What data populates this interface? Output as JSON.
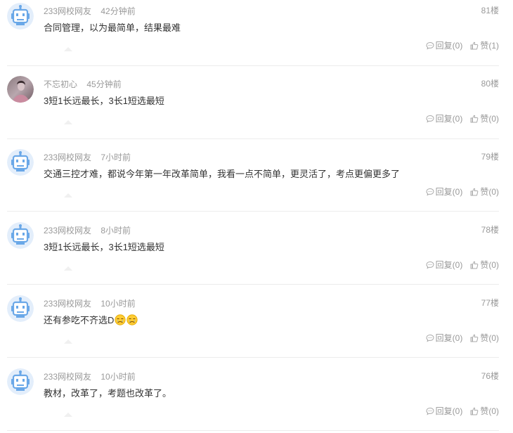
{
  "comments": [
    {
      "user": "233网校网友",
      "time": "42分钟前",
      "floor": "81楼",
      "content": "合同管理，以为最简单，结果最难",
      "reply_label": "回复(0)",
      "like_label": "赞(1)",
      "avatar": "robot-avatar"
    },
    {
      "user": "不忘初心",
      "time": "45分钟前",
      "floor": "80楼",
      "content": "3短1长远最长，3长1短选最短",
      "reply_label": "回复(0)",
      "like_label": "赞(0)",
      "avatar": "photo-avatar"
    },
    {
      "user": "233网校网友",
      "time": "7小时前",
      "floor": "79楼",
      "content": "交通三控才难，都说今年第一年改革简单，我看一点不简单，更灵活了，考点更偏更多了",
      "reply_label": "回复(0)",
      "like_label": "赞(0)",
      "avatar": "robot-avatar"
    },
    {
      "user": "233网校网友",
      "time": "8小时前",
      "floor": "78楼",
      "content": "3短1长远最长，3长1短选最短",
      "reply_label": "回复(0)",
      "like_label": "赞(0)",
      "avatar": "robot-avatar"
    },
    {
      "user": "233网校网友",
      "time": "10小时前",
      "floor": "77楼",
      "content": "还有参吃不齐选D",
      "reply_label": "回复(0)",
      "like_label": "赞(0)",
      "avatar": "robot-avatar",
      "emojis": [
        "crying-face-emoji",
        "crying-face-emoji"
      ]
    },
    {
      "user": "233网校网友",
      "time": "10小时前",
      "floor": "76楼",
      "content": "教材，改革了，考题也改革了。",
      "reply_label": "回复(0)",
      "like_label": "赞(0)",
      "avatar": "robot-avatar"
    }
  ],
  "icons": {
    "reply": "comment-icon",
    "like": "thumbs-up-icon"
  },
  "colors": {
    "text": "#333333",
    "muted": "#999999",
    "divider": "#ececec",
    "avatar_bg": "#e3eefb",
    "robot": "#6aa8e8"
  }
}
